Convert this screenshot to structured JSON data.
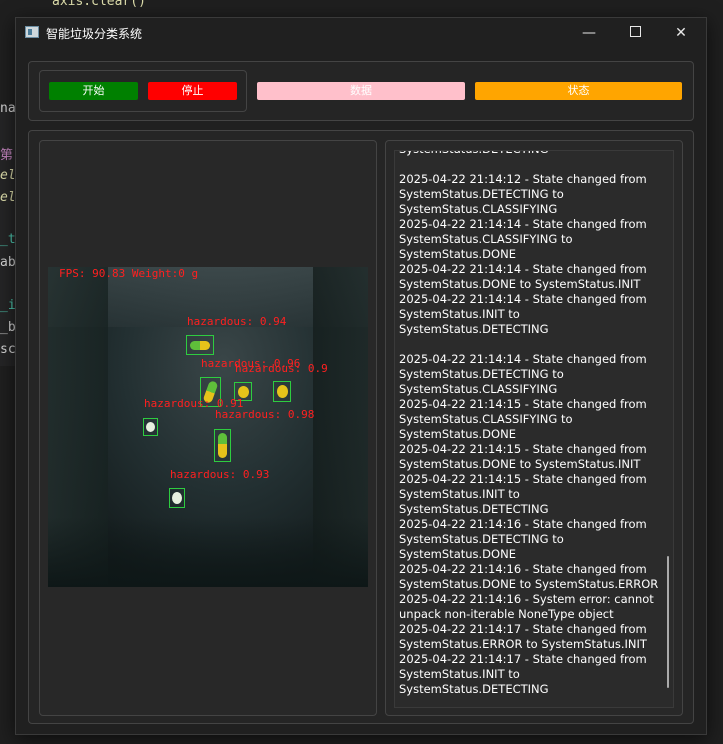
{
  "window": {
    "title": "智能垃圾分类系统",
    "minimize_glyph": "—",
    "close_glyph": "✕"
  },
  "background_editor": {
    "top_line": "axis.clear()",
    "side_fragments": [
      "nar",
      "第",
      "elf",
      "elf",
      "_t",
      "ab",
      "_i",
      "_b",
      "scr"
    ]
  },
  "toolbar": {
    "start_label": "开始",
    "stop_label": "停止",
    "data_label": "数据",
    "status_label": "状态"
  },
  "colors": {
    "start": "#008000",
    "stop": "#ff0000",
    "data": "#ffc0cb",
    "status": "#ffa500",
    "detection_box": "#2ecc40",
    "detection_text": "#ff2020"
  },
  "video": {
    "overlay_text": "FPS: 90.83 Weight:0 g",
    "detections": [
      {
        "label": "hazardous: 0.94"
      },
      {
        "label": "hazardous: 0.96"
      },
      {
        "label": "hazardous: 0.9"
      },
      {
        "label": "hazardous: 0.91"
      },
      {
        "label": "hazardous: 0.98"
      },
      {
        "label": "hazardous: 0.93"
      }
    ]
  },
  "log": {
    "text": "SystemStatus.DETECTING\n\n2025-04-22 21:14:12 - State changed from SystemStatus.DETECTING to SystemStatus.CLASSIFYING\n2025-04-22 21:14:14 - State changed from SystemStatus.CLASSIFYING to SystemStatus.DONE\n2025-04-22 21:14:14 - State changed from SystemStatus.DONE to SystemStatus.INIT\n2025-04-22 21:14:14 - State changed from SystemStatus.INIT to SystemStatus.DETECTING\n\n2025-04-22 21:14:14 - State changed from SystemStatus.DETECTING to SystemStatus.CLASSIFYING\n2025-04-22 21:14:15 - State changed from SystemStatus.CLASSIFYING to SystemStatus.DONE\n2025-04-22 21:14:15 - State changed from SystemStatus.DONE to SystemStatus.INIT\n2025-04-22 21:14:15 - State changed from SystemStatus.INIT to SystemStatus.DETECTING\n2025-04-22 21:14:16 - State changed from SystemStatus.DETECTING to SystemStatus.DONE\n2025-04-22 21:14:16 - State changed from SystemStatus.DONE to SystemStatus.ERROR\n2025-04-22 21:14:16 - System error: cannot unpack non-iterable NoneType object\n2025-04-22 21:14:17 - State changed from SystemStatus.ERROR to SystemStatus.INIT\n2025-04-22 21:14:17 - State changed from SystemStatus.INIT to SystemStatus.DETECTING"
  }
}
